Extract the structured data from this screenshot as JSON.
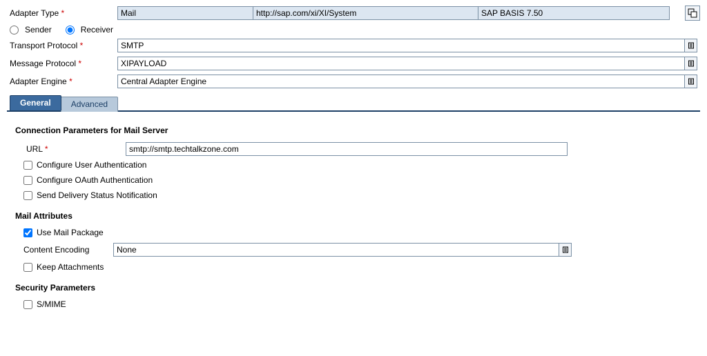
{
  "adapterType": {
    "label": "Adapter Type",
    "value": "Mail",
    "namespace": "http://sap.com/xi/XI/System",
    "swcv": "SAP BASIS 7.50"
  },
  "direction": {
    "sender": "Sender",
    "receiver": "Receiver",
    "selected": "receiver"
  },
  "transportProtocol": {
    "label": "Transport Protocol",
    "value": "SMTP"
  },
  "messageProtocol": {
    "label": "Message Protocol",
    "value": "XIPAYLOAD"
  },
  "adapterEngine": {
    "label": "Adapter Engine",
    "value": "Central Adapter Engine"
  },
  "tabs": {
    "general": "General",
    "advanced": "Advanced"
  },
  "sections": {
    "connParams": "Connection Parameters for Mail Server",
    "mailAttrs": "Mail Attributes",
    "securityParams": "Security Parameters"
  },
  "url": {
    "label": "URL",
    "value": "smtp://smtp.techtalkzone.com"
  },
  "checkboxes": {
    "userAuth": "Configure User Authentication",
    "oauth": "Configure OAuth Authentication",
    "dsn": "Send Delivery Status Notification",
    "useMailPackage": "Use Mail Package",
    "keepAttachments": "Keep Attachments",
    "smime": "S/MIME"
  },
  "contentEncoding": {
    "label": "Content Encoding",
    "value": "None"
  }
}
